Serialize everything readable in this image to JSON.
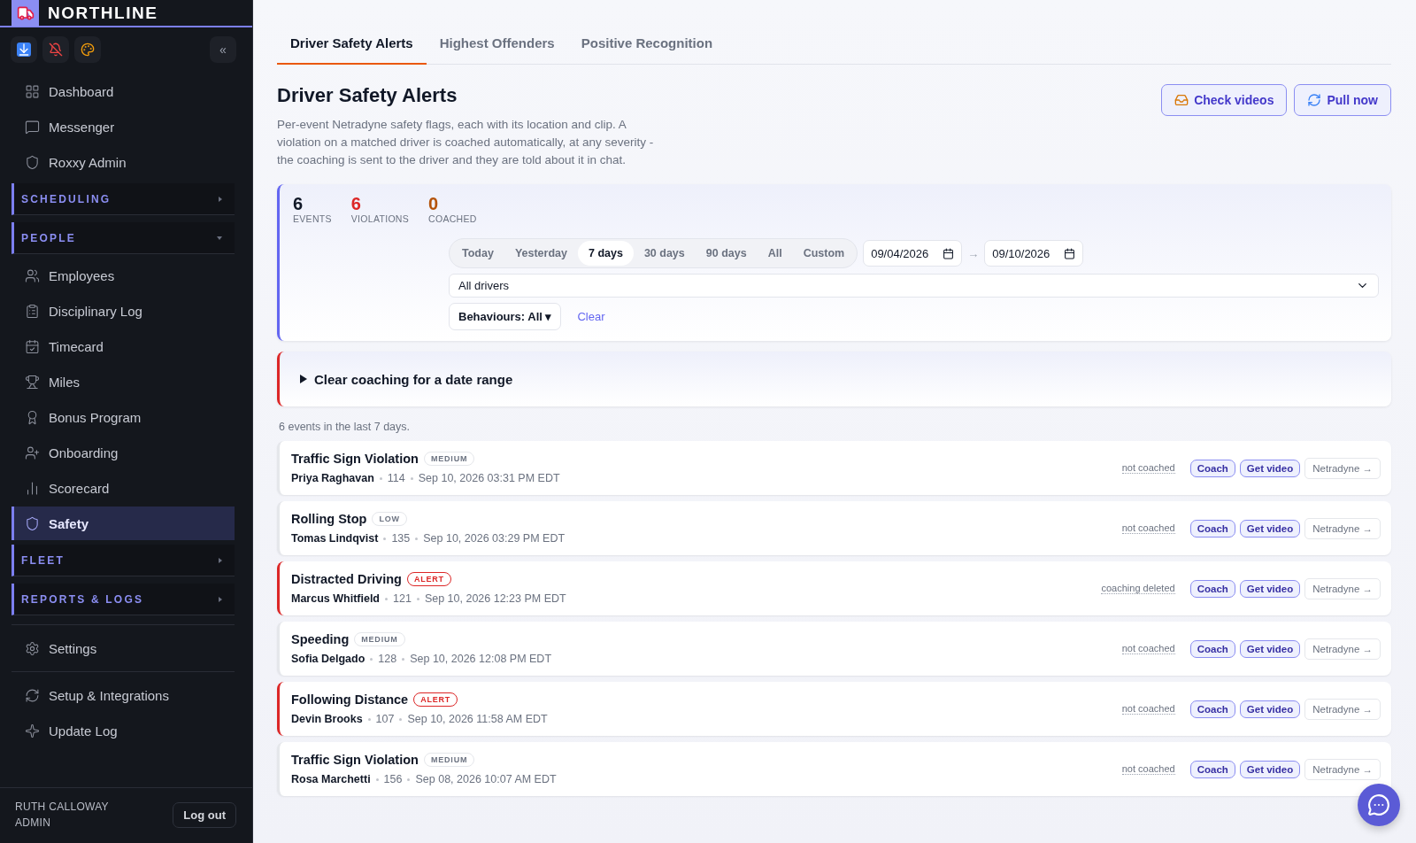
{
  "brand": {
    "name": "NORTHLINE"
  },
  "sidebar": {
    "collapse": "«",
    "groups": [
      [
        {
          "kind": "item",
          "label": "Dashboard",
          "selected": false
        },
        {
          "kind": "item",
          "label": "Messenger",
          "selected": false
        },
        {
          "kind": "item",
          "label": "Roxxy Admin",
          "selected": false
        },
        {
          "kind": "section",
          "label": "SCHEDULING",
          "expanded": false
        },
        {
          "kind": "section",
          "label": "PEOPLE",
          "expanded": true,
          "children": [
            {
              "kind": "item",
              "label": "Employees",
              "selected": false
            },
            {
              "kind": "item",
              "label": "Disciplinary Log",
              "selected": false
            },
            {
              "kind": "item",
              "label": "Timecard",
              "selected": false
            },
            {
              "kind": "item",
              "label": "Miles",
              "selected": false
            },
            {
              "kind": "item",
              "label": "Bonus Program",
              "selected": false
            },
            {
              "kind": "item",
              "label": "Onboarding",
              "selected": false
            },
            {
              "kind": "item",
              "label": "Scorecard",
              "selected": false
            },
            {
              "kind": "item",
              "label": "Safety",
              "selected": true
            }
          ]
        },
        {
          "kind": "section",
          "label": "FLEET",
          "expanded": false
        },
        {
          "kind": "section",
          "label": "REPORTS & LOGS",
          "expanded": false
        }
      ],
      [
        {
          "kind": "item",
          "label": "Settings",
          "selected": false
        }
      ],
      [
        {
          "kind": "item",
          "label": "Setup & Integrations",
          "selected": false
        },
        {
          "kind": "item",
          "label": "Update Log",
          "selected": false
        }
      ]
    ],
    "user": {
      "name": "RUTH CALLOWAY",
      "role": "ADMIN",
      "logout": "Log out"
    }
  },
  "tabs": [
    {
      "label": "Driver Safety Alerts",
      "selected": true
    },
    {
      "label": "Highest Offenders",
      "selected": false
    },
    {
      "label": "Positive Recognition",
      "selected": false
    }
  ],
  "page": {
    "title": "Driver Safety Alerts",
    "description": "Per-event Netradyne safety flags, each with its location and clip. A violation on a matched driver is coached automatically, at any severity - the coaching is sent to the driver and they are told about it in chat.",
    "actions": [
      "Check videos",
      "Pull now"
    ]
  },
  "filters": {
    "stats": [
      {
        "value": "6",
        "label": "EVENTS",
        "color": "#111827"
      },
      {
        "value": "6",
        "label": "VIOLATIONS",
        "color": "#dc2626"
      },
      {
        "value": "0",
        "label": "COACHED",
        "color": "#b45309"
      }
    ],
    "ranges": [
      {
        "label": "Today",
        "selected": false
      },
      {
        "label": "Yesterday",
        "selected": false
      },
      {
        "label": "7 days",
        "selected": true
      },
      {
        "label": "30 days",
        "selected": false
      },
      {
        "label": "90 days",
        "selected": false
      },
      {
        "label": "All",
        "selected": false
      },
      {
        "label": "Custom",
        "selected": false
      }
    ],
    "date_from": "09/04/2026",
    "date_separator": "→",
    "date_to": "09/10/2026",
    "driver_select": "All drivers",
    "behaviours": "Behaviours: All ▾",
    "clear": "Clear"
  },
  "clear_coaching": {
    "label": "Clear coaching for a date range",
    "expanded": false
  },
  "summary": "6 events in the last 7 days.",
  "events": [
    {
      "title": "Traffic Sign Violation",
      "severity": {
        "label": "MEDIUM",
        "kind": "medium"
      },
      "driver": "Priya Raghavan",
      "unit": "114",
      "time": "Sep 10, 2026 03:31 PM EDT",
      "status": "not coached",
      "actions": [
        "Coach",
        "Get video",
        "Netradyne →"
      ]
    },
    {
      "title": "Rolling Stop",
      "severity": {
        "label": "LOW",
        "kind": "low"
      },
      "driver": "Tomas Lindqvist",
      "unit": "135",
      "time": "Sep 10, 2026 03:29 PM EDT",
      "status": "not coached",
      "actions": [
        "Coach",
        "Get video",
        "Netradyne →"
      ]
    },
    {
      "title": "Distracted Driving",
      "severity": {
        "label": "ALERT",
        "kind": "alert"
      },
      "driver": "Marcus Whitfield",
      "unit": "121",
      "time": "Sep 10, 2026 12:23 PM EDT",
      "status": "coaching deleted",
      "actions": [
        "Coach",
        "Get video",
        "Netradyne →"
      ]
    },
    {
      "title": "Speeding",
      "severity": {
        "label": "MEDIUM",
        "kind": "medium"
      },
      "driver": "Sofia Delgado",
      "unit": "128",
      "time": "Sep 10, 2026 12:08 PM EDT",
      "status": "not coached",
      "actions": [
        "Coach",
        "Get video",
        "Netradyne →"
      ]
    },
    {
      "title": "Following Distance",
      "severity": {
        "label": "ALERT",
        "kind": "alert"
      },
      "driver": "Devin Brooks",
      "unit": "107",
      "time": "Sep 10, 2026 11:58 AM EDT",
      "status": "not coached",
      "actions": [
        "Coach",
        "Get video",
        "Netradyne →"
      ]
    },
    {
      "title": "Traffic Sign Violation",
      "severity": {
        "label": "MEDIUM",
        "kind": "medium"
      },
      "driver": "Rosa Marchetti",
      "unit": "156",
      "time": "Sep 08, 2026 10:07 AM EDT",
      "status": "not coached",
      "actions": [
        "Coach",
        "Get video",
        "Netradyne →"
      ]
    }
  ]
}
